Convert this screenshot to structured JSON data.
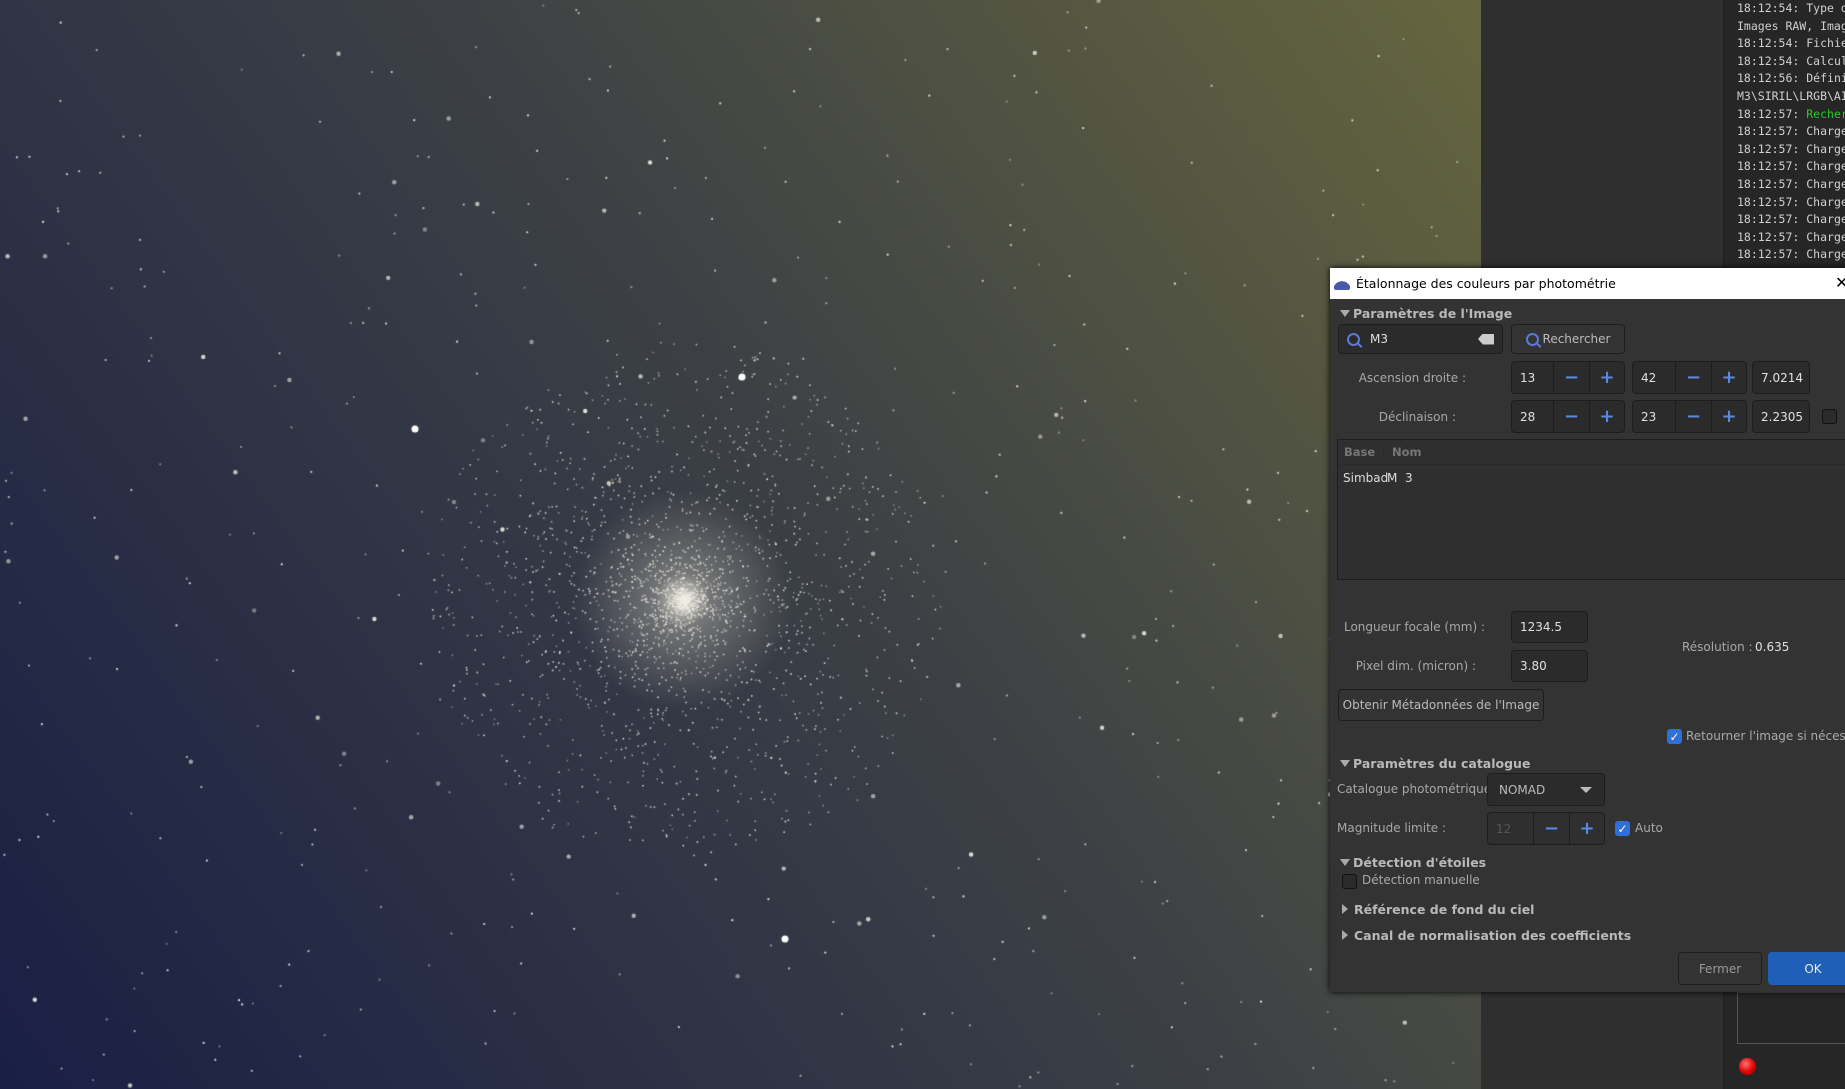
{
  "log": {
    "lines": [
      {
        "time": "18:12:54:",
        "text": "Type d"
      },
      {
        "time": "",
        "text": "Images RAW, Imag"
      },
      {
        "time": "18:12:54:",
        "text": "Fichie"
      },
      {
        "time": "18:12:54:",
        "text": "Calcul"
      },
      {
        "time": "18:12:56:",
        "text": "Défini"
      },
      {
        "time": "",
        "text": "M3\\SIRIL\\LRGB\\AI"
      },
      {
        "time": "18:12:57:",
        "text": "Recher",
        "green": true
      },
      {
        "time": "18:12:57:",
        "text": "Charge"
      },
      {
        "time": "18:12:57:",
        "text": "Charge"
      },
      {
        "time": "18:12:57:",
        "text": "Charge"
      },
      {
        "time": "18:12:57:",
        "text": "Charge"
      },
      {
        "time": "18:12:57:",
        "text": "Charge"
      },
      {
        "time": "18:12:57:",
        "text": "Charge"
      },
      {
        "time": "18:12:57:",
        "text": "Charge"
      },
      {
        "time": "18:12:57:",
        "text": "Charge"
      }
    ],
    "status_color": "#e00000"
  },
  "dialog": {
    "title": "Étalonnage des couleurs par photométrie",
    "close": "✕",
    "image_params": {
      "header": "Paramètres de l'Image",
      "search_value": "M3",
      "search_button": "Rechercher",
      "ra_label": "Ascension droite :",
      "ra_h": "13",
      "ra_m": "42",
      "ra_s": "7.0214",
      "dec_label": "Déclinaison :",
      "dec_d": "28",
      "dec_m": "23",
      "dec_s": "2.2305",
      "table_headers": [
        "Base",
        "Nom"
      ],
      "table_rows": [
        [
          "Simbad",
          "M  3"
        ]
      ],
      "focal_label": "Longueur focale (mm) :",
      "focal_value": "1234.5",
      "pixel_label": "Pixel dim. (micron) :",
      "pixel_value": "3.80",
      "resolution_label": "Résolution :",
      "resolution_value": "0.635",
      "metadata_button": "Obtenir Métadonnées de l'Image",
      "flip_label": "Retourner l'image si nécessaire",
      "flip_checked": true,
      "south_checked": false
    },
    "catalog": {
      "header": "Paramètres du catalogue",
      "catalog_label": "Catalogue photométrique :",
      "catalog_value": "NOMAD",
      "mag_label": "Magnitude limite :",
      "mag_value": "12",
      "auto_label": "Auto",
      "auto_checked": true
    },
    "stars": {
      "header": "Détection d'étoiles",
      "manual_label": "Détection manuelle",
      "manual_checked": false
    },
    "background_header": "Référence de fond du ciel",
    "normalization_header": "Canal de normalisation des coefficients",
    "close_button": "Fermer",
    "ok_button": "OK",
    "accent": "#1f5fb8"
  }
}
